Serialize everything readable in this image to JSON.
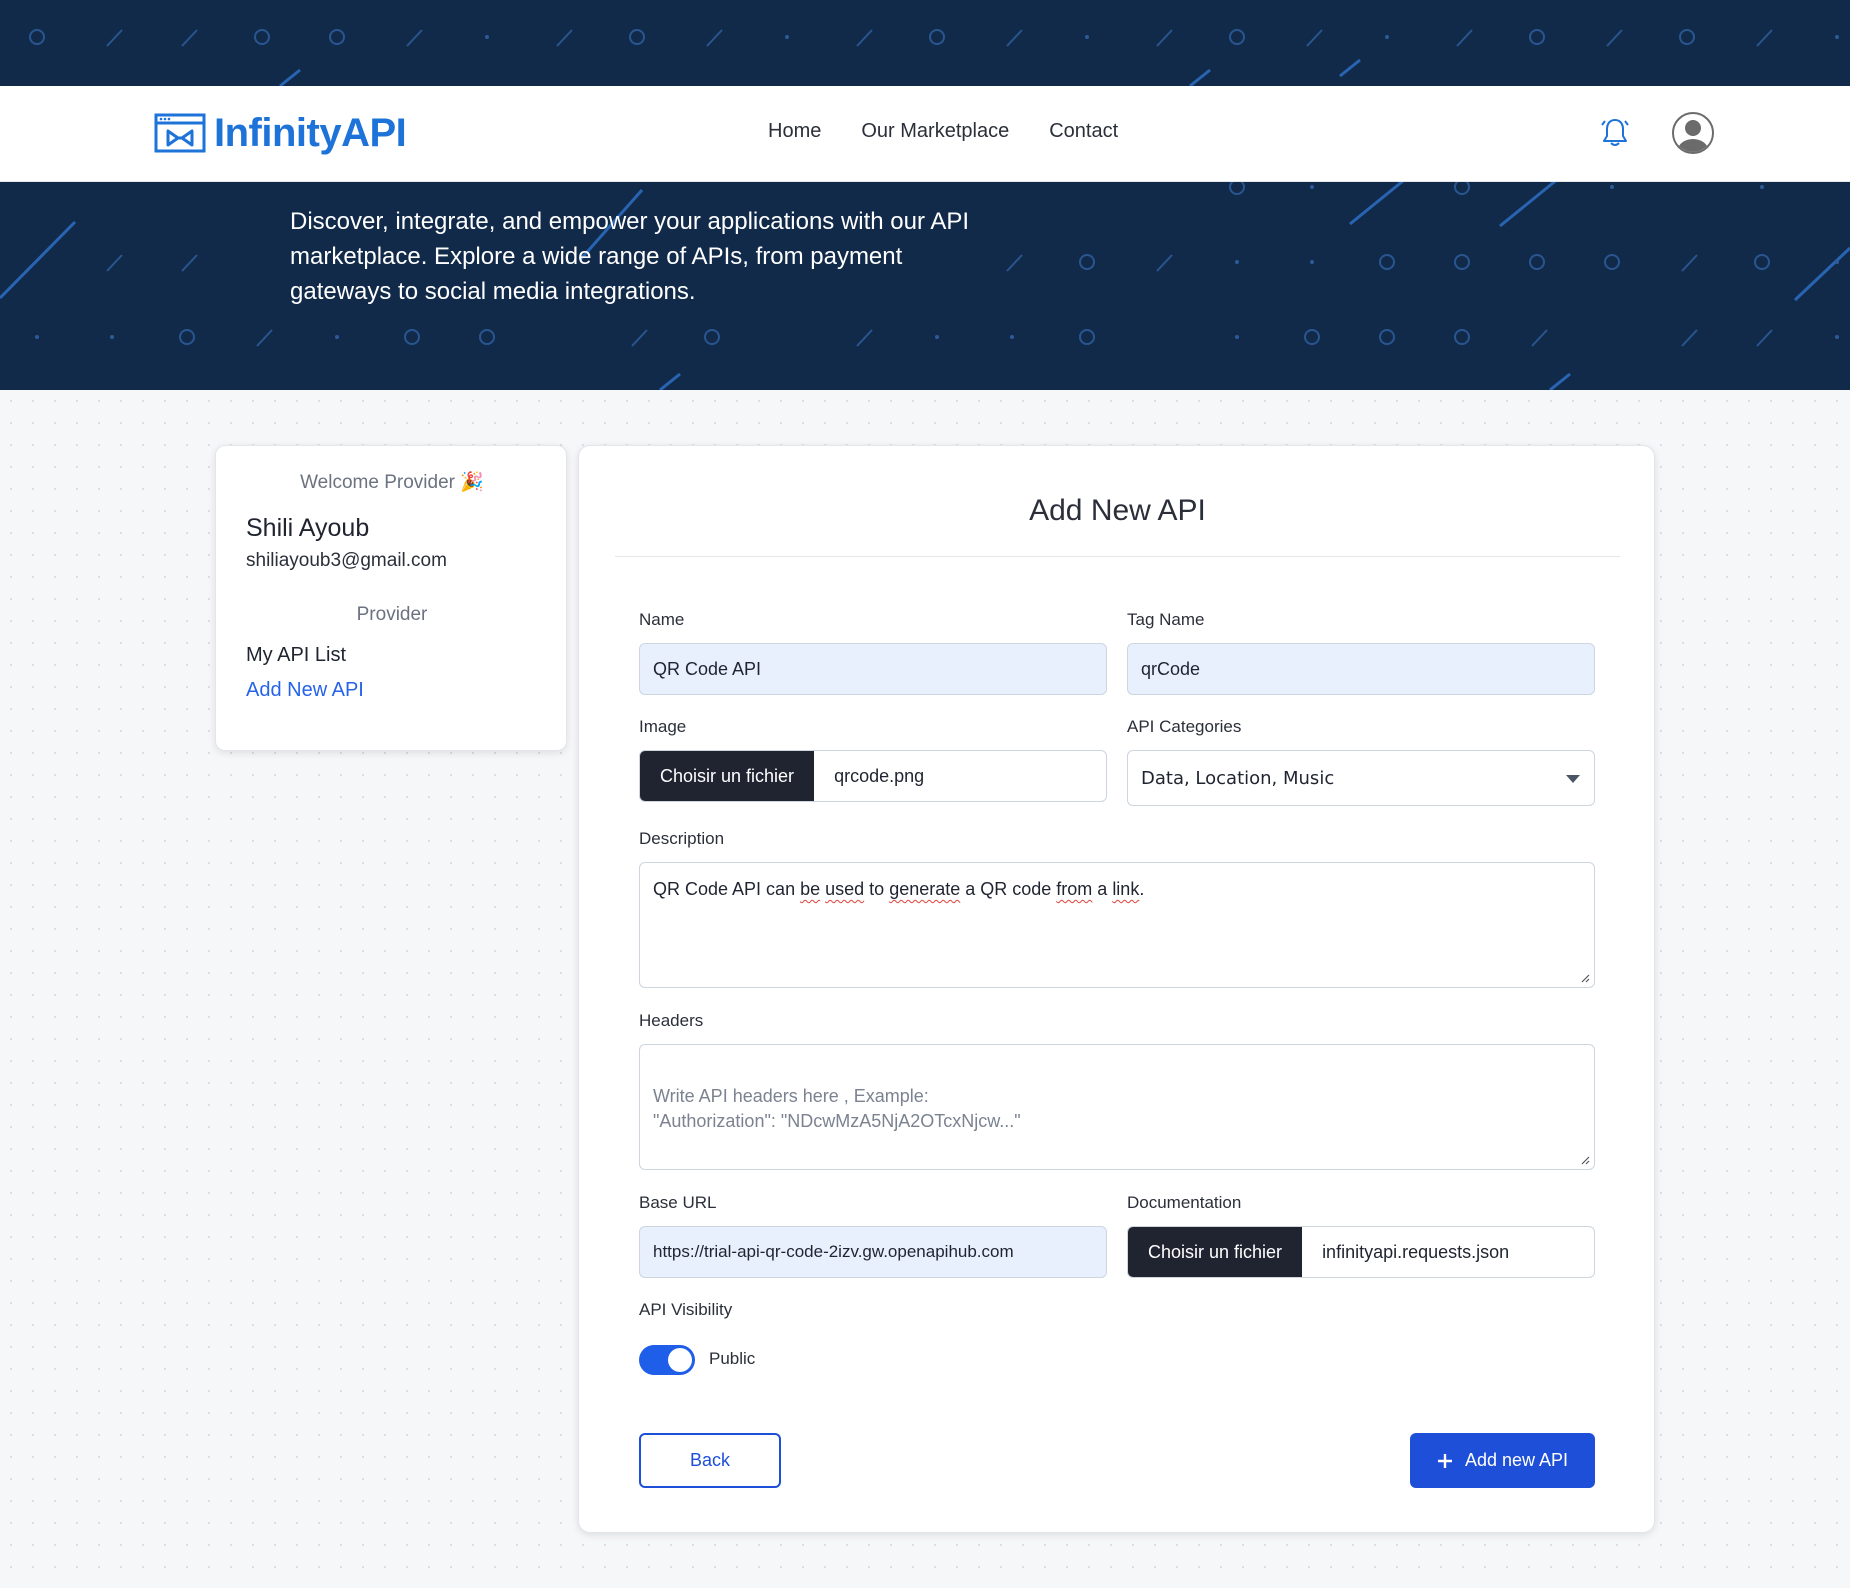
{
  "brand": {
    "name": "InfinityAPI",
    "color": "#1e73d8",
    "logo_icon": "window-bowtie-icon"
  },
  "nav": {
    "links": [
      "Home",
      "Our Marketplace",
      "Contact"
    ],
    "bell_icon": "bell-icon",
    "avatar_icon": "user-avatar-icon"
  },
  "hero": {
    "text": "Discover, integrate, and empower your applications with our API marketplace. Explore a wide range of APIs, from payment gateways to social media integrations.",
    "background": "#122a4a"
  },
  "sidebar": {
    "welcome": "Welcome Provider 🎉",
    "user_name": "Shili Ayoub",
    "email": "shiliayoub3@gmail.com",
    "role": "Provider",
    "links": [
      "My API List",
      "Add New API"
    ],
    "active_link_color": "#2563eb"
  },
  "form": {
    "title": "Add New API",
    "name": {
      "label": "Name",
      "value": "QR Code API"
    },
    "tag_name": {
      "label": "Tag Name",
      "value": "qrCode"
    },
    "image": {
      "label": "Image",
      "button": "Choisir un fichier",
      "file": "qrcode.png"
    },
    "categories": {
      "label": "API Categories",
      "value": "Data, Location, Music"
    },
    "description": {
      "label": "Description",
      "parts": [
        "QR Code API can ",
        "be",
        " ",
        "used",
        " to ",
        "generate",
        " a QR code ",
        "from",
        " a ",
        "link",
        "."
      ]
    },
    "headers": {
      "label": "Headers",
      "placeholder": "Write API headers here , Example:\n\"Authorization\": \"NDcwMzA5NjA2OTcxNjcw...\""
    },
    "base_url": {
      "label": "Base URL",
      "value": "https://trial-api-qr-code-2izv.gw.openapihub.com"
    },
    "documentation": {
      "label": "Documentation",
      "button": "Choisir un fichier",
      "file": "infinityapi.requests.json"
    },
    "visibility": {
      "label": "API Visibility",
      "state": "Public",
      "on": true
    },
    "back_label": "Back",
    "submit_label": "Add new API",
    "accent": "#1e4fd8"
  }
}
